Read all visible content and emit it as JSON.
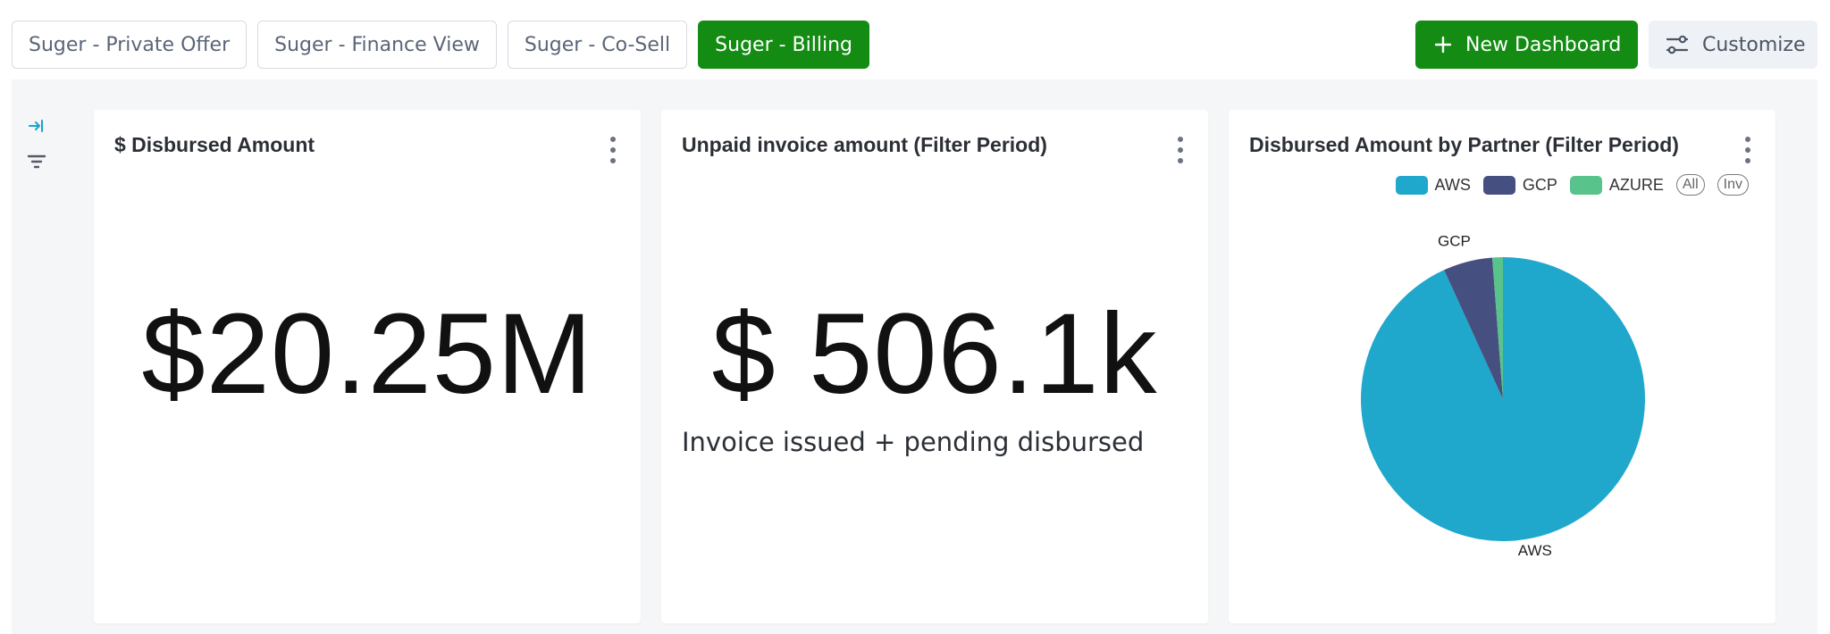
{
  "tabs": [
    {
      "label": "Suger - Private Offer",
      "active": false
    },
    {
      "label": "Suger - Finance View",
      "active": false
    },
    {
      "label": "Suger - Co-Sell",
      "active": false
    },
    {
      "label": "Suger - Billing",
      "active": true
    }
  ],
  "actions": {
    "new_dashboard_label": "New Dashboard",
    "customize_label": "Customize"
  },
  "cards": {
    "disbursed": {
      "title": "$ Disbursed Amount",
      "value": "$20.25M"
    },
    "unpaid": {
      "title": "Unpaid invoice amount (Filter Period)",
      "value": "$ 506.1k",
      "subtitle": "Invoice issued + pending disbursed"
    },
    "by_partner": {
      "title": "Disbursed Amount by Partner (Filter Period)",
      "legend_all": "All",
      "legend_inv": "Inv"
    }
  },
  "colors": {
    "brand_green": "#148c14",
    "aws": "#20a7cc",
    "gcp": "#465080",
    "azure": "#58c38a"
  },
  "icons": {
    "plus": "plus-icon",
    "customize": "sliders-icon",
    "collapse": "expand-right-icon",
    "filter": "filter-icon",
    "menu": "kebab-icon"
  },
  "chart_data": {
    "type": "pie",
    "title": "Disbursed Amount by Partner (Filter Period)",
    "categories": [
      "AWS",
      "GCP",
      "AZURE"
    ],
    "values": [
      93.2,
      5.6,
      1.2
    ],
    "legend": "top-right",
    "slice_labels": [
      "AWS",
      "GCP"
    ]
  }
}
